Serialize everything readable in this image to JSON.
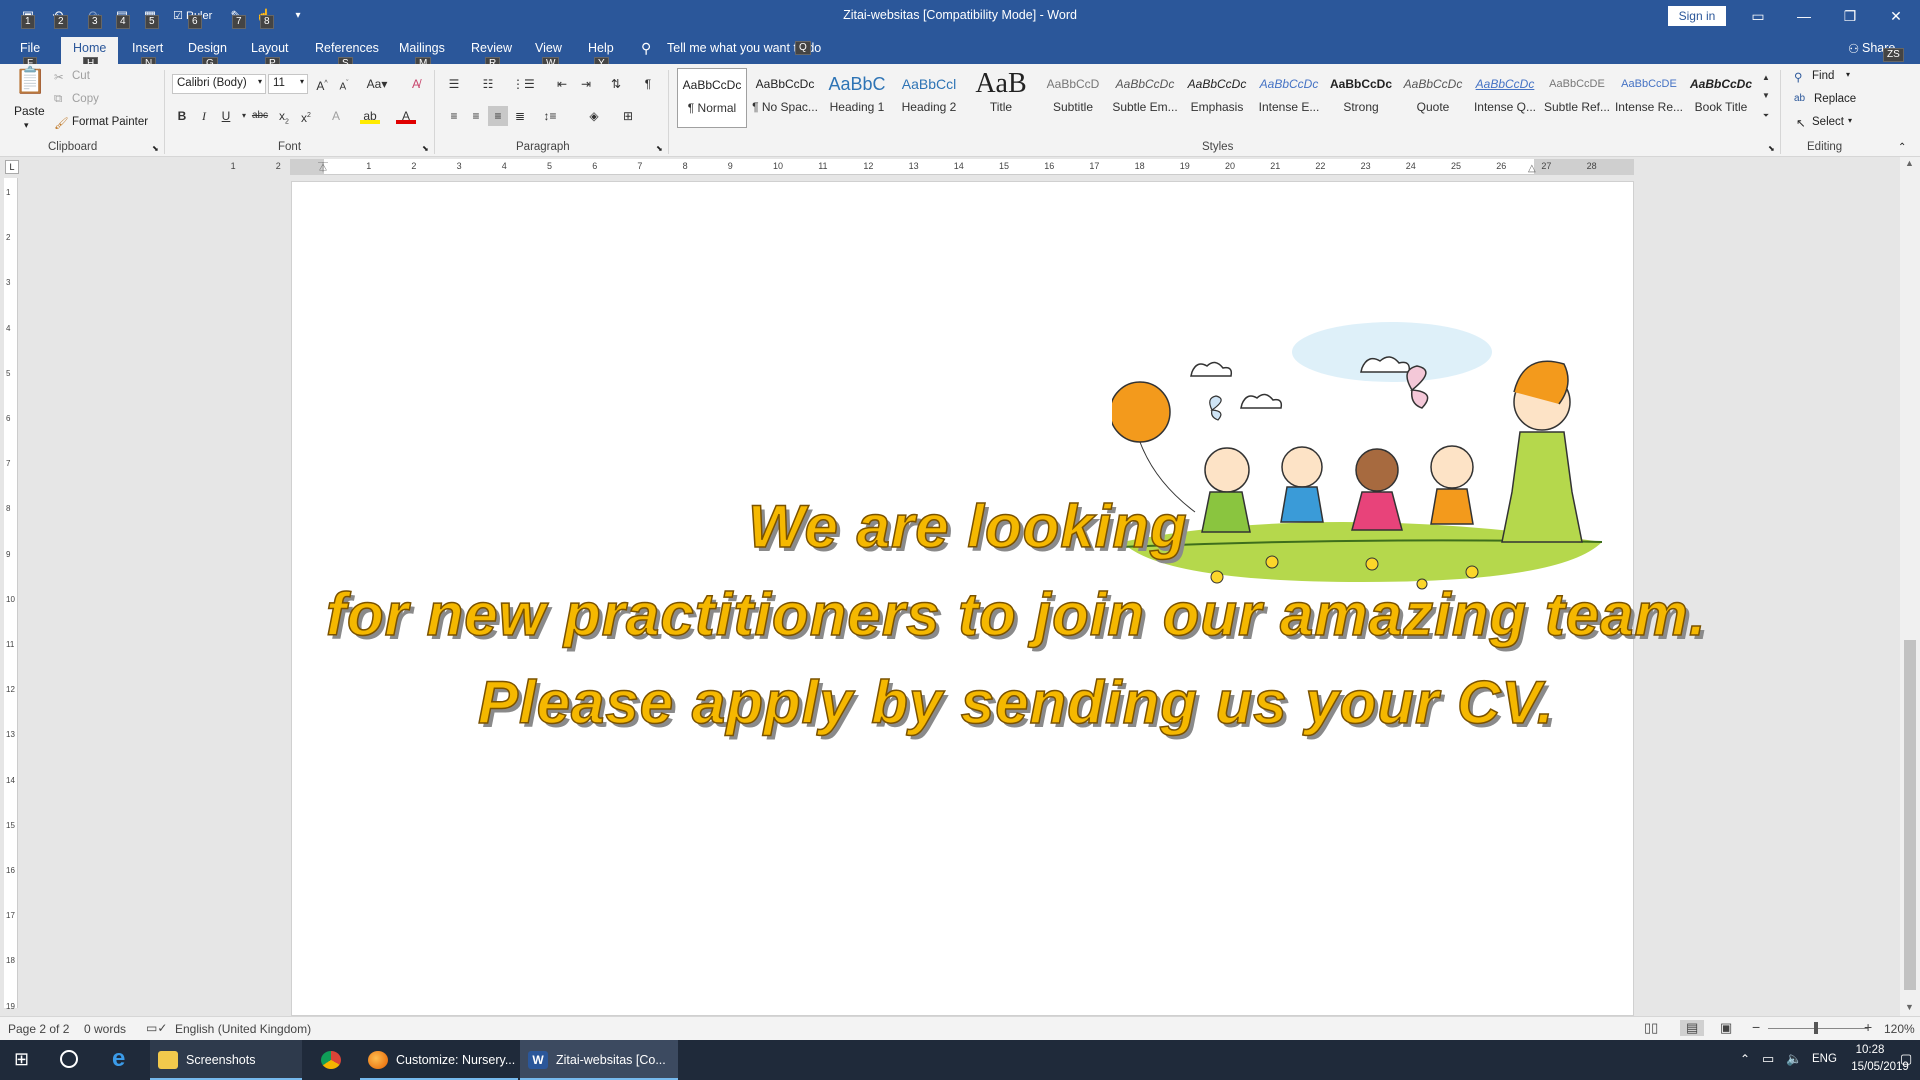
{
  "window": {
    "title": "Zitai-websitas [Compatibility Mode]  -  Word",
    "sign_in": "Sign in",
    "qat_keytips": [
      "1",
      "2",
      "3",
      "4",
      "5",
      "6",
      "7",
      "8"
    ],
    "qat_ruler_label": "Ruler"
  },
  "tabs": [
    {
      "label": "File",
      "key": "F"
    },
    {
      "label": "Home",
      "key": "H"
    },
    {
      "label": "Insert",
      "key": "N"
    },
    {
      "label": "Design",
      "key": "G"
    },
    {
      "label": "Layout",
      "key": "P"
    },
    {
      "label": "References",
      "key": "S"
    },
    {
      "label": "Mailings",
      "key": "M"
    },
    {
      "label": "Review",
      "key": "R"
    },
    {
      "label": "View",
      "key": "W"
    },
    {
      "label": "Help",
      "key": "Y"
    }
  ],
  "tell_me": {
    "text": "Tell me what you want to do",
    "key": "Q"
  },
  "share": {
    "label": "Share",
    "key": "ZS"
  },
  "clipboard": {
    "paste": "Paste",
    "cut": "Cut",
    "copy": "Copy",
    "format_painter": "Format Painter",
    "group": "Clipboard"
  },
  "font": {
    "name": "Calibri (Body)",
    "size": "11",
    "group": "Font"
  },
  "paragraph": {
    "group": "Paragraph"
  },
  "styles": {
    "group": "Styles",
    "items": [
      {
        "preview": "AaBbCcDc",
        "name": "¶ Normal"
      },
      {
        "preview": "AaBbCcDc",
        "name": "¶ No Spac..."
      },
      {
        "preview": "AaBbC",
        "name": "Heading 1"
      },
      {
        "preview": "AaBbCcl",
        "name": "Heading 2"
      },
      {
        "preview": "AaB",
        "name": "Title"
      },
      {
        "preview": "AaBbCcD",
        "name": "Subtitle"
      },
      {
        "preview": "AaBbCcDc",
        "name": "Subtle Em..."
      },
      {
        "preview": "AaBbCcDc",
        "name": "Emphasis"
      },
      {
        "preview": "AaBbCcDc",
        "name": "Intense E..."
      },
      {
        "preview": "AaBbCcDc",
        "name": "Strong"
      },
      {
        "preview": "AaBbCcDc",
        "name": "Quote"
      },
      {
        "preview": "AaBbCcDc",
        "name": "Intense Q..."
      },
      {
        "preview": "AaBbCcDE",
        "name": "Subtle Ref..."
      },
      {
        "preview": "AaBbCcDE",
        "name": "Intense Re..."
      },
      {
        "preview": "AaBbCcDc",
        "name": "Book Title"
      }
    ]
  },
  "editing": {
    "find": "Find",
    "replace": "Replace",
    "select": "Select",
    "group": "Editing"
  },
  "ruler_numbers": [
    "1",
    "2",
    "1",
    "2",
    "3",
    "4",
    "5",
    "6",
    "7",
    "8",
    "9",
    "10",
    "11",
    "12",
    "13",
    "14",
    "15",
    "16",
    "17",
    "18",
    "19",
    "20",
    "21",
    "22",
    "23",
    "24",
    "25",
    "26",
    "27",
    "28"
  ],
  "vruler_numbers": [
    "1",
    "2",
    "3",
    "4",
    "5",
    "6",
    "7",
    "8",
    "9",
    "10",
    "11",
    "12",
    "13",
    "14",
    "15",
    "16",
    "17",
    "18",
    "19"
  ],
  "document": {
    "line1": "We are looking",
    "line2": "for new practitioners to join our amazing team.",
    "line3": "Please apply by sending us your CV."
  },
  "status": {
    "page": "Page 2 of 2",
    "words": "0 words",
    "language": "English (United Kingdom)",
    "zoom": "120%"
  },
  "taskbar": {
    "apps": [
      {
        "label": "Screenshots"
      },
      {
        "label": ""
      },
      {
        "label": "Customize: Nursery..."
      },
      {
        "label": "Zitai-websitas [Co..."
      }
    ],
    "lang": "ENG",
    "time": "10:28",
    "date": "15/05/2019"
  },
  "colors": {
    "word_blue": "#2b579a",
    "wordart_fill": "#f5b800"
  }
}
